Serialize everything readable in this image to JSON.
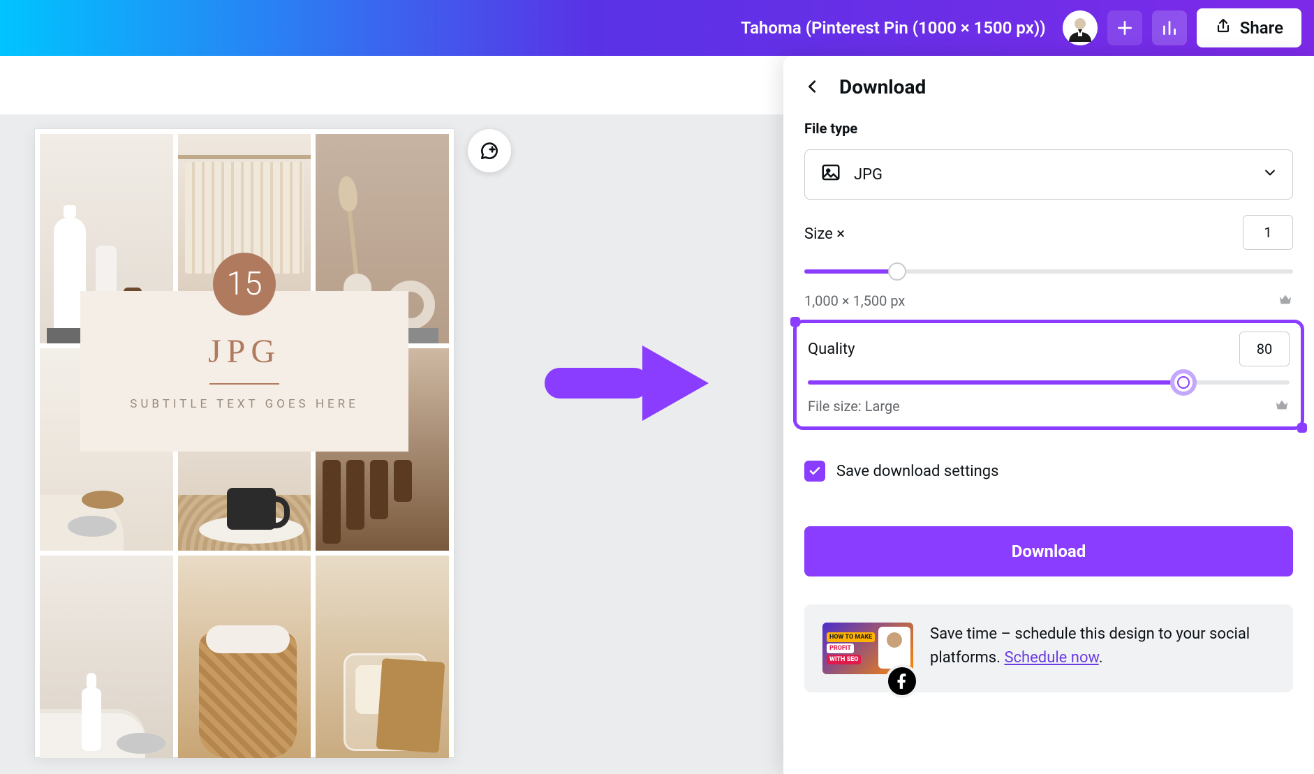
{
  "header": {
    "doc_title": "Tahoma (Pinterest Pin (1000 × 1500 px))",
    "share_label": "Share"
  },
  "design": {
    "badge_number": "15",
    "heading": "JPG",
    "subtitle": "SUBTITLE TEXT GOES HERE"
  },
  "download": {
    "title": "Download",
    "filetype_label": "File type",
    "filetype_value": "JPG",
    "size_label": "Size ×",
    "size_value": "1",
    "size_slider_pct": 19,
    "dimensions": "1,000 × 1,500 px",
    "quality_label": "Quality",
    "quality_value": "80",
    "quality_slider_pct": 78,
    "filesize_hint": "File size: Large",
    "save_settings_label": "Save download settings",
    "save_settings_checked": true,
    "button_label": "Download",
    "promo": {
      "thumb_lines": [
        "HOW TO MAKE",
        "PROFIT",
        "WITH SEO"
      ],
      "text_prefix": "Save time – schedule this design to your social platforms. ",
      "link_text": "Schedule now",
      "text_suffix": "."
    }
  }
}
